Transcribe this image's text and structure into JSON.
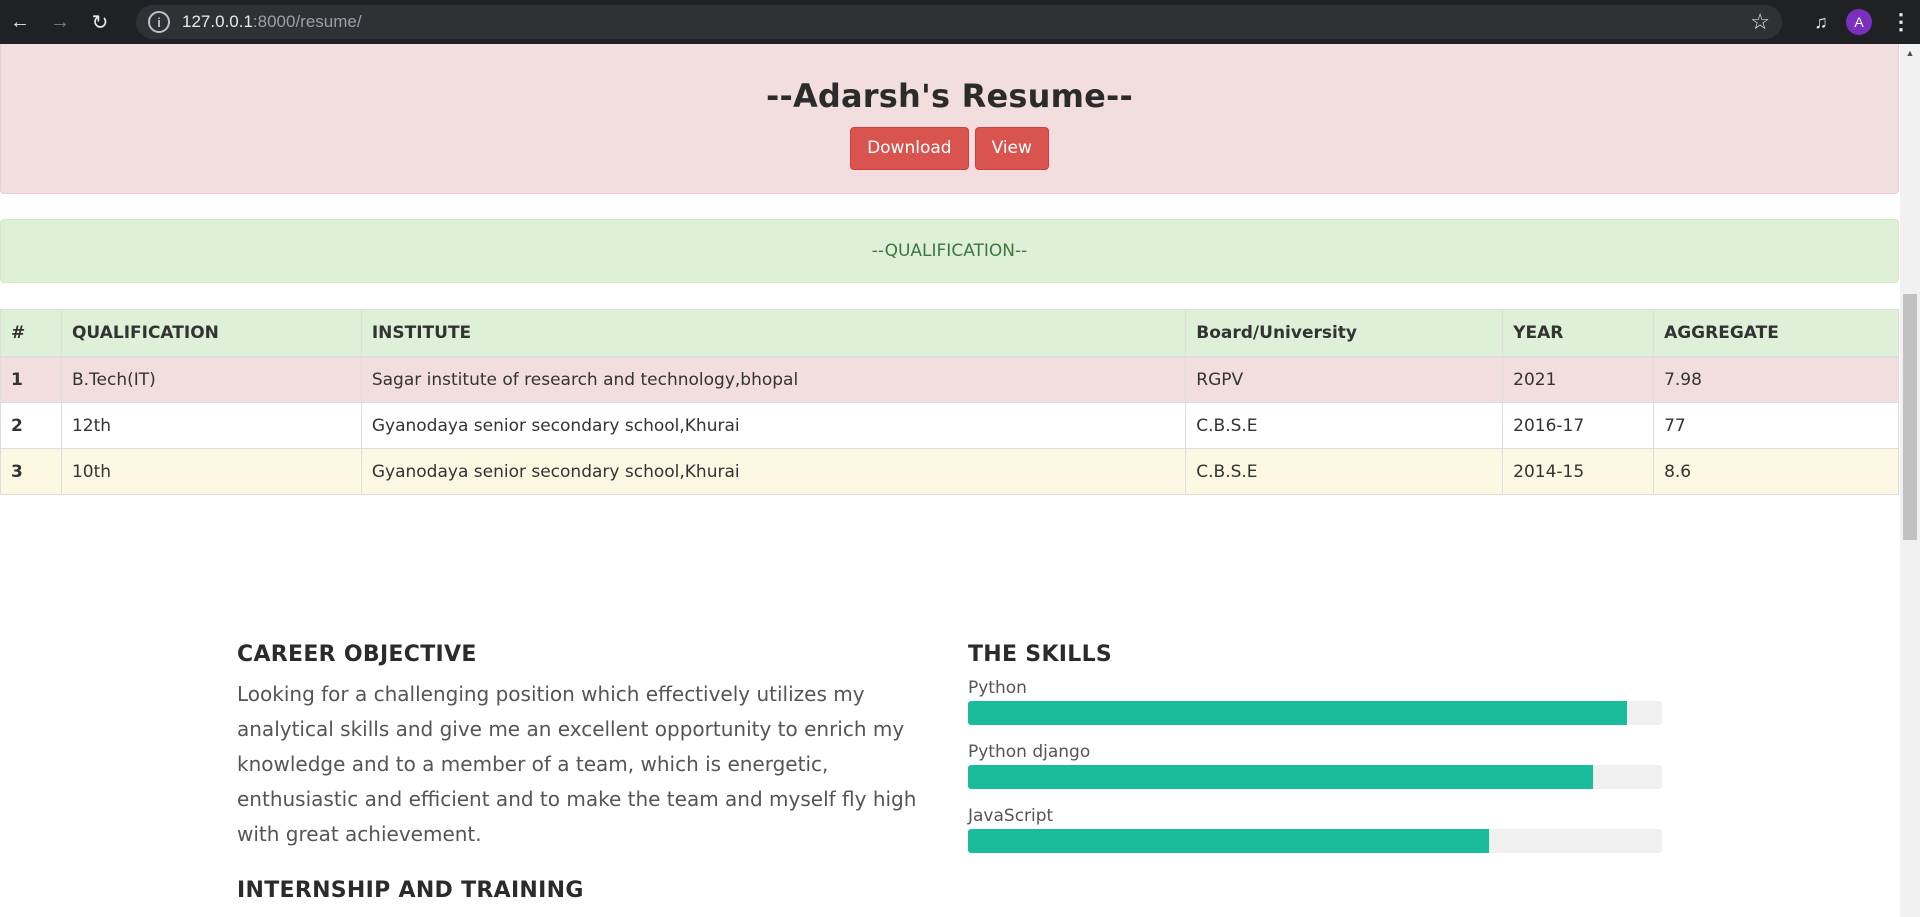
{
  "browser": {
    "url_host": "127.0.0.1",
    "url_rest": ":8000/resume/",
    "profile_initial": "A"
  },
  "header": {
    "title": "--Adarsh's Resume--",
    "download_label": "Download",
    "view_label": "View"
  },
  "qualification_banner": "--QUALIFICATION--",
  "table": {
    "headers": [
      "#",
      "QUALIFICATION",
      "INSTITUTE",
      "Board/University",
      "YEAR",
      "AGGREGATE"
    ],
    "rows": [
      [
        "1",
        "B.Tech(IT)",
        "Sagar institute of research and technology,bhopal",
        "RGPV",
        "2021",
        "7.98"
      ],
      [
        "2",
        "12th",
        "Gyanodaya senior secondary school,Khurai",
        "C.B.S.E",
        "2016-17",
        "77"
      ],
      [
        "3",
        "10th",
        "Gyanodaya senior secondary school,Khurai",
        "C.B.S.E",
        "2014-15",
        "8.6"
      ]
    ]
  },
  "career": {
    "heading": "CAREER OBJECTIVE",
    "text": "Looking for a challenging position which effectively utilizes my analytical skills and give me an excellent opportunity to enrich my knowledge and to a member of a team, which is energetic, enthusiastic and efficient and to make the team and myself fly high with great achievement.",
    "internship_heading": "INTERNSHIP AND TRAINING"
  },
  "skills": {
    "heading": "THE SKILLS",
    "items": [
      {
        "name": "Python",
        "percent": 95
      },
      {
        "name": "Python django",
        "percent": 90
      },
      {
        "name": "JavaScript",
        "percent": 75
      }
    ]
  },
  "colors": {
    "skill_fill": "#1abc9c",
    "danger": "#d9534f"
  }
}
